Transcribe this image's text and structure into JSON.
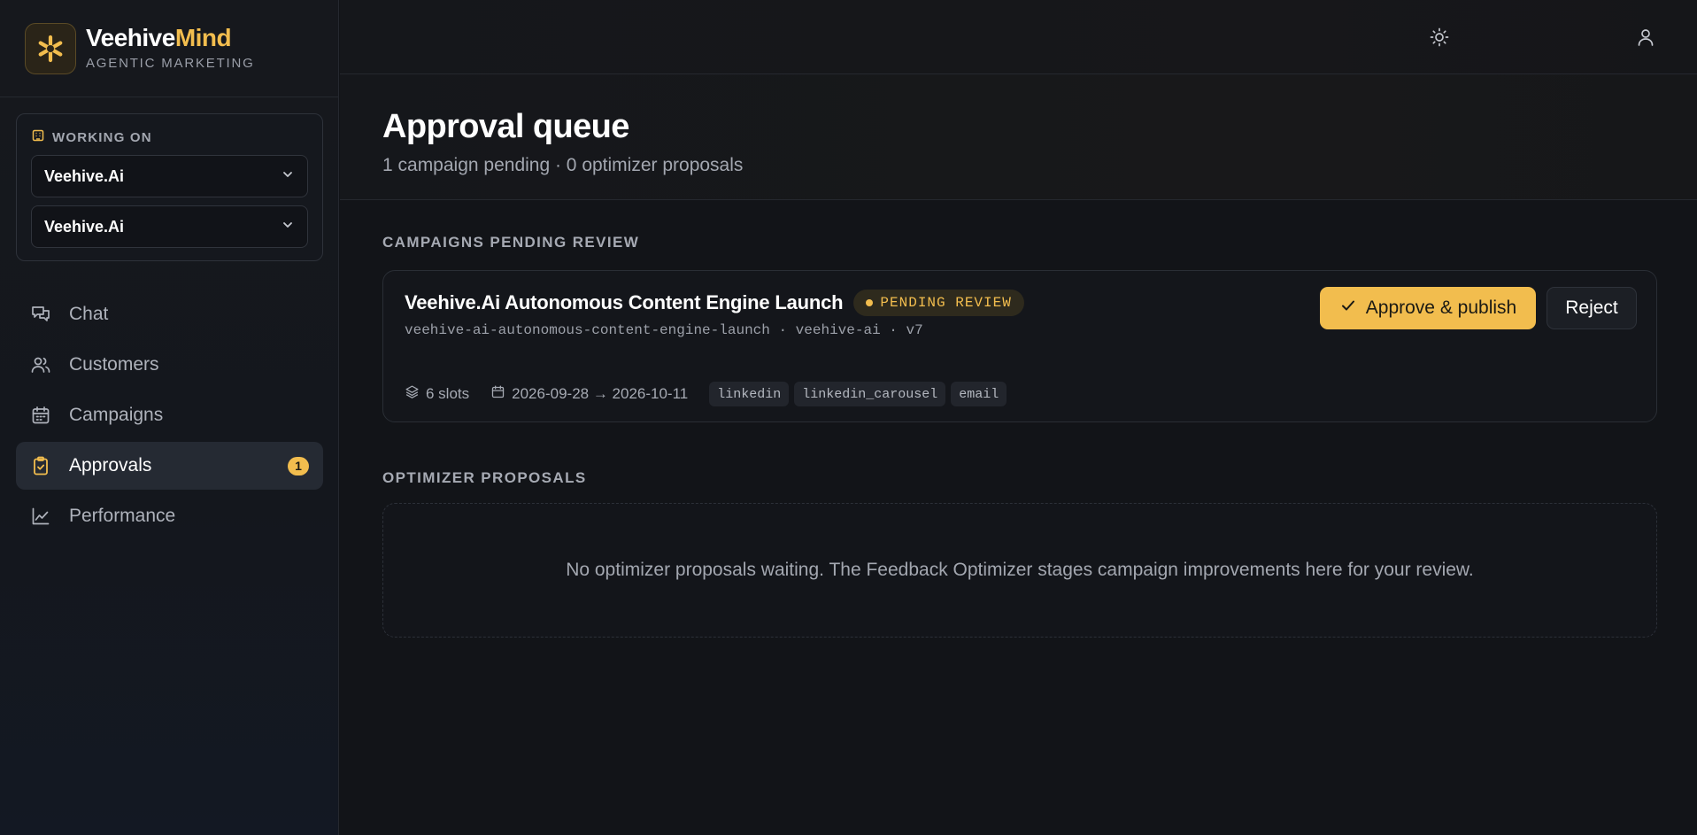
{
  "brand": {
    "name_part1": "Veehive",
    "name_part2": "Mind",
    "subtitle": "AGENTIC MARKETING",
    "logo_icon": "asterisk-logo-icon",
    "accent_color": "#f2bd4e"
  },
  "workspace": {
    "label": "WORKING ON",
    "icon": "building-icon",
    "org_select": "Veehive.Ai",
    "project_select": "Veehive.Ai"
  },
  "nav": {
    "items": [
      {
        "label": "Chat",
        "icon": "chat-icon",
        "active": false
      },
      {
        "label": "Customers",
        "icon": "users-icon",
        "active": false
      },
      {
        "label": "Campaigns",
        "icon": "calendar-icon",
        "active": false
      },
      {
        "label": "Approvals",
        "icon": "clipboard-check-icon",
        "active": true,
        "badge": "1"
      },
      {
        "label": "Performance",
        "icon": "line-chart-icon",
        "active": false
      }
    ]
  },
  "topbar": {
    "theme_icon": "sun-icon",
    "user_icon": "user-icon"
  },
  "page": {
    "title": "Approval queue",
    "subtitle": "1 campaign pending · 0 optimizer proposals"
  },
  "campaigns_section": {
    "label": "CAMPAIGNS PENDING REVIEW",
    "campaign": {
      "title": "Veehive.Ai Autonomous Content Engine Launch",
      "status": "PENDING REVIEW",
      "slug": "veehive-ai-autonomous-content-engine-launch · veehive-ai · v7",
      "slots": "6 slots",
      "date_range": "2026-09-28 → 2026-10-11",
      "channels": [
        "linkedin",
        "linkedin_carousel",
        "email"
      ],
      "approve_label": "Approve & publish",
      "reject_label": "Reject"
    }
  },
  "optimizer_section": {
    "label": "OPTIMIZER PROPOSALS",
    "empty_message": "No optimizer proposals waiting. The Feedback Optimizer stages campaign improvements here for your review."
  }
}
